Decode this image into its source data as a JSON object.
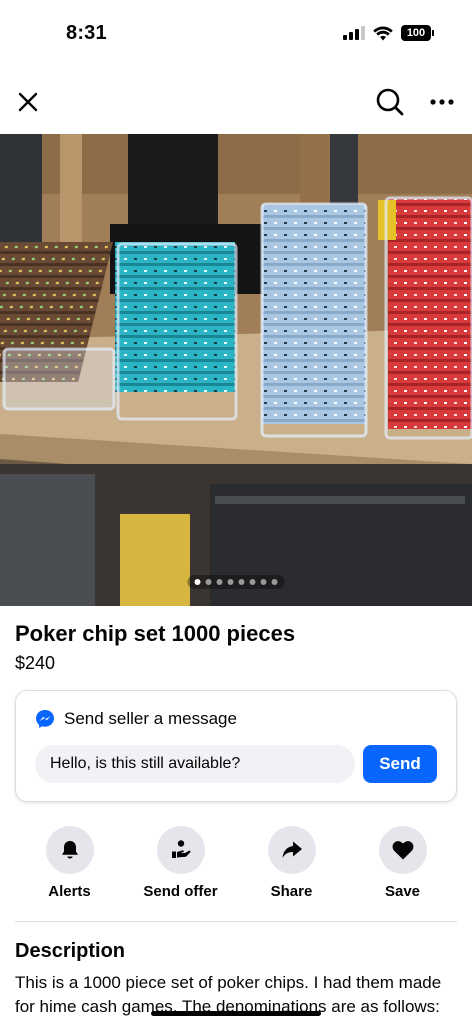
{
  "status": {
    "time": "8:31",
    "battery": "100"
  },
  "nav": {
    "close_icon": "close-icon",
    "search_icon": "search-icon",
    "more_icon": "more-icon"
  },
  "photo": {
    "page_count": 8,
    "current_page": 1
  },
  "listing": {
    "title": "Poker chip set 1000 pieces",
    "price": "$240"
  },
  "message": {
    "header": "Send seller a message",
    "input_value": "Hello, is this still available?",
    "send_label": "Send"
  },
  "actions": [
    {
      "label": "Alerts",
      "icon": "bell-icon"
    },
    {
      "label": "Send offer",
      "icon": "offer-icon"
    },
    {
      "label": "Share",
      "icon": "share-icon"
    },
    {
      "label": "Save",
      "icon": "heart-icon"
    }
  ],
  "description": {
    "title": "Description",
    "text": "This is a 1000 piece set of poker chips. I had them made for hime cash games. The denominations are as follows: ..."
  },
  "colors": {
    "accent": "#0866ff",
    "surface": "#e4e6eb",
    "input_bg": "#f0f2f5"
  }
}
